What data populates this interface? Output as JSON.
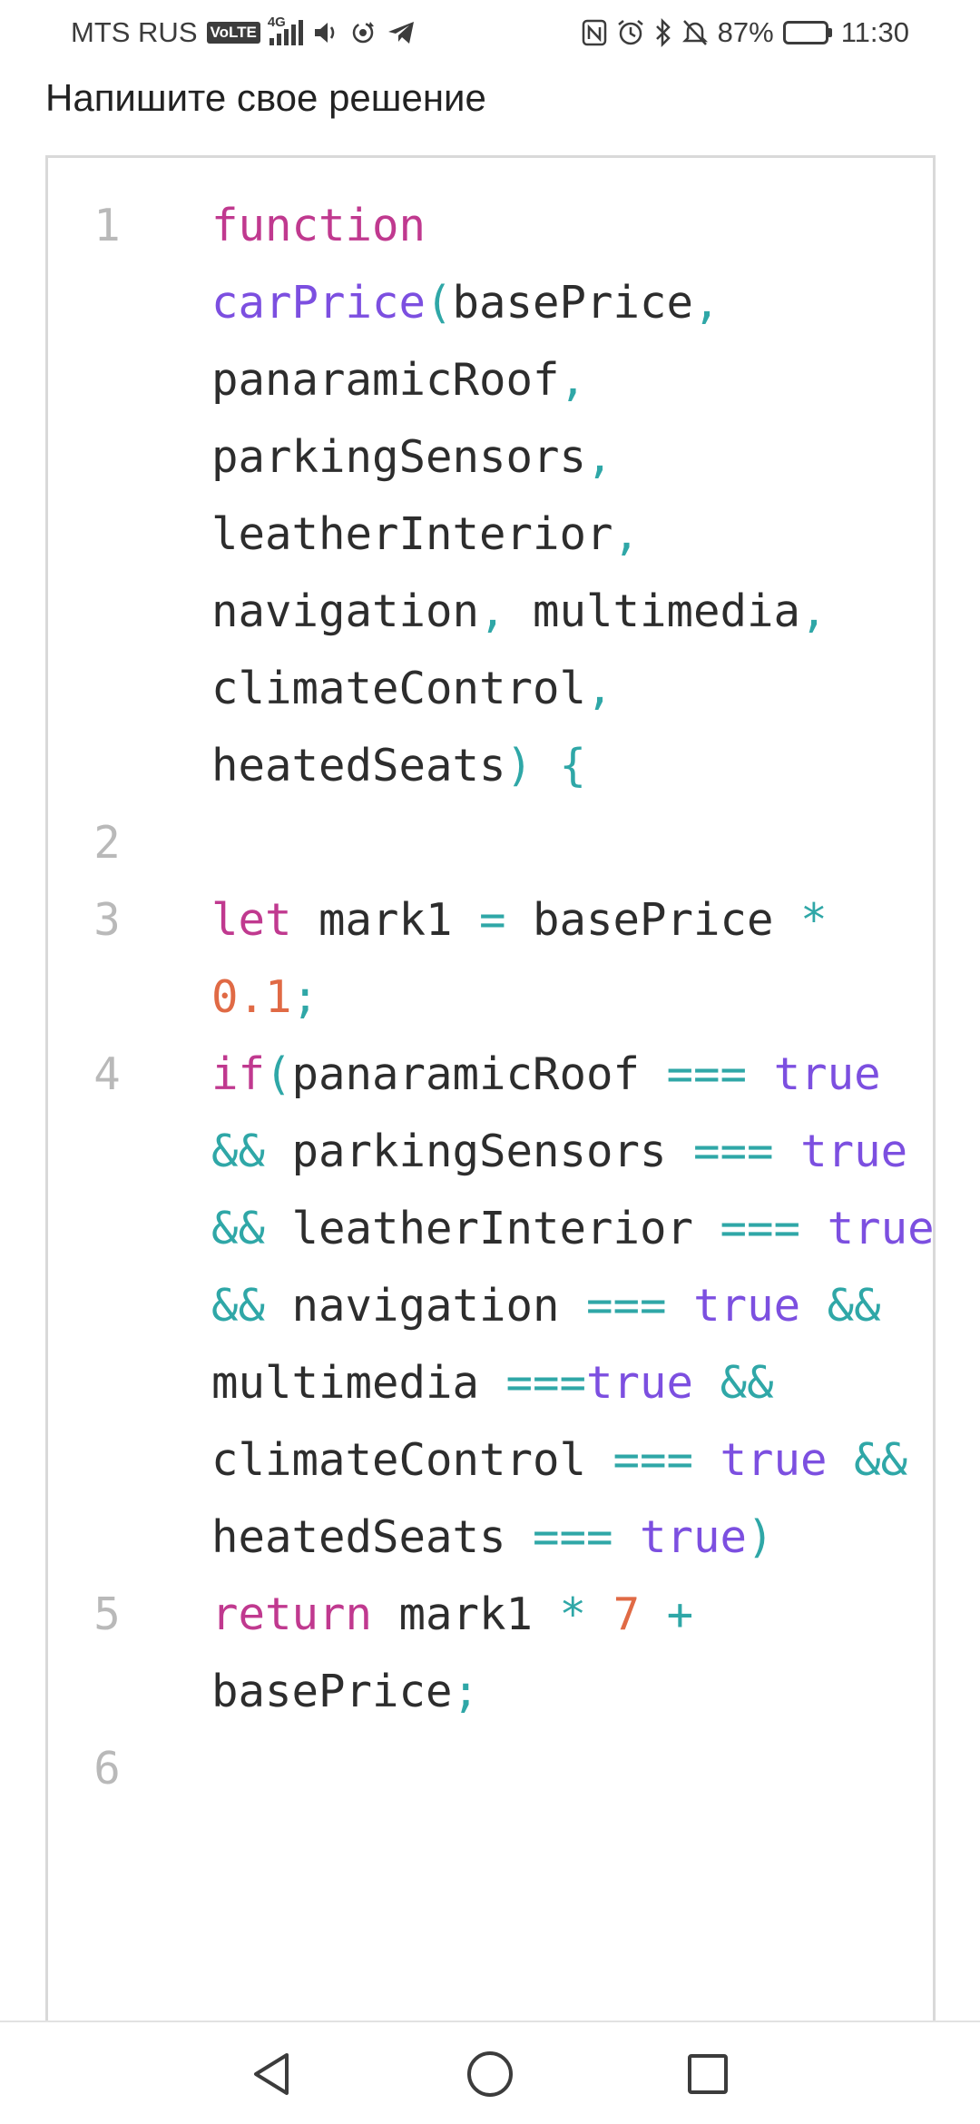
{
  "status_bar": {
    "carrier": "MTS RUS",
    "volte": "VoLTE",
    "network_gen": "4G",
    "battery_percent": "87%",
    "battery_level": 0.87,
    "time": "11:30",
    "icons_left": [
      "volte-icon",
      "signal-icon",
      "volume-icon",
      "sync-icon",
      "telegram-icon"
    ],
    "icons_right": [
      "nfc-icon",
      "alarm-icon",
      "bluetooth-icon",
      "silent-icon",
      "battery-icon"
    ]
  },
  "prompt": {
    "title": "Напишите свое решение"
  },
  "editor": {
    "lines": [
      {
        "num": "1",
        "tokens": [
          {
            "t": "function",
            "c": "kw"
          },
          {
            "t": " ",
            "c": ""
          },
          {
            "t": "carPrice",
            "c": "fn"
          },
          {
            "t": "(",
            "c": "op"
          },
          {
            "t": "basePrice",
            "c": ""
          },
          {
            "t": ",",
            "c": "op"
          },
          {
            "t": " panaramicRoof",
            "c": ""
          },
          {
            "t": ",",
            "c": "op"
          },
          {
            "t": " parkingSensors",
            "c": ""
          },
          {
            "t": ",",
            "c": "op"
          },
          {
            "t": " leatherInterior",
            "c": ""
          },
          {
            "t": ",",
            "c": "op"
          },
          {
            "t": " navigation",
            "c": ""
          },
          {
            "t": ",",
            "c": "op"
          },
          {
            "t": " multimedia",
            "c": ""
          },
          {
            "t": ",",
            "c": "op"
          },
          {
            "t": " climateControl",
            "c": ""
          },
          {
            "t": ",",
            "c": "op"
          },
          {
            "t": " heatedSeats",
            "c": ""
          },
          {
            "t": ")",
            "c": "op"
          },
          {
            "t": " ",
            "c": ""
          },
          {
            "t": "{",
            "c": "op"
          }
        ]
      },
      {
        "num": "2",
        "tokens": []
      },
      {
        "num": "3",
        "tokens": [
          {
            "t": "let",
            "c": "kw"
          },
          {
            "t": " mark1 ",
            "c": ""
          },
          {
            "t": "=",
            "c": "op"
          },
          {
            "t": " basePrice ",
            "c": ""
          },
          {
            "t": "*",
            "c": "op"
          },
          {
            "t": " ",
            "c": ""
          },
          {
            "t": "0.1",
            "c": "num"
          },
          {
            "t": ";",
            "c": "op"
          }
        ]
      },
      {
        "num": "4",
        "tokens": [
          {
            "t": "if",
            "c": "kw"
          },
          {
            "t": "(",
            "c": "op"
          },
          {
            "t": "panaramicRoof ",
            "c": ""
          },
          {
            "t": "===",
            "c": "op"
          },
          {
            "t": " ",
            "c": ""
          },
          {
            "t": "true",
            "c": "bool"
          },
          {
            "t": " ",
            "c": ""
          },
          {
            "t": "&&",
            "c": "op"
          },
          {
            "t": " parkingSensors ",
            "c": ""
          },
          {
            "t": "===",
            "c": "op"
          },
          {
            "t": " ",
            "c": ""
          },
          {
            "t": "true",
            "c": "bool"
          },
          {
            "t": " ",
            "c": ""
          },
          {
            "t": "&&",
            "c": "op"
          },
          {
            "t": " leatherInterior ",
            "c": ""
          },
          {
            "t": "===",
            "c": "op"
          },
          {
            "t": " ",
            "c": ""
          },
          {
            "t": "true",
            "c": "bool"
          },
          {
            "t": " ",
            "c": ""
          },
          {
            "t": "&&",
            "c": "op"
          },
          {
            "t": " navigation ",
            "c": ""
          },
          {
            "t": "===",
            "c": "op"
          },
          {
            "t": " ",
            "c": ""
          },
          {
            "t": "true",
            "c": "bool"
          },
          {
            "t": " ",
            "c": ""
          },
          {
            "t": "&&",
            "c": "op"
          },
          {
            "t": " multimedia ",
            "c": ""
          },
          {
            "t": "===",
            "c": "op"
          },
          {
            "t": "true",
            "c": "bool"
          },
          {
            "t": " ",
            "c": ""
          },
          {
            "t": "&&",
            "c": "op"
          },
          {
            "t": " climateControl ",
            "c": ""
          },
          {
            "t": "===",
            "c": "op"
          },
          {
            "t": " ",
            "c": ""
          },
          {
            "t": "true",
            "c": "bool"
          },
          {
            "t": " ",
            "c": ""
          },
          {
            "t": "&&",
            "c": "op"
          },
          {
            "t": " heatedSeats ",
            "c": ""
          },
          {
            "t": "===",
            "c": "op"
          },
          {
            "t": " ",
            "c": ""
          },
          {
            "t": "true",
            "c": "bool"
          },
          {
            "t": ")",
            "c": "op"
          }
        ]
      },
      {
        "num": "5",
        "tokens": [
          {
            "t": "return",
            "c": "kw"
          },
          {
            "t": " mark1 ",
            "c": ""
          },
          {
            "t": "*",
            "c": "op"
          },
          {
            "t": " ",
            "c": ""
          },
          {
            "t": "7",
            "c": "num"
          },
          {
            "t": " ",
            "c": ""
          },
          {
            "t": "+",
            "c": "op"
          },
          {
            "t": " basePrice",
            "c": ""
          },
          {
            "t": ";",
            "c": "op"
          }
        ]
      },
      {
        "num": "6",
        "tokens": []
      }
    ]
  },
  "nav_bar": {
    "buttons": [
      "back-icon",
      "home-icon",
      "recents-icon"
    ]
  },
  "colors": {
    "keyword": "#c0398f",
    "function": "#7c4fe0",
    "operator": "#2fa7a7",
    "number": "#e06a45",
    "boolean": "#7c4fe0",
    "text": "#2d2d2d",
    "line_number": "#b9b9b9"
  }
}
